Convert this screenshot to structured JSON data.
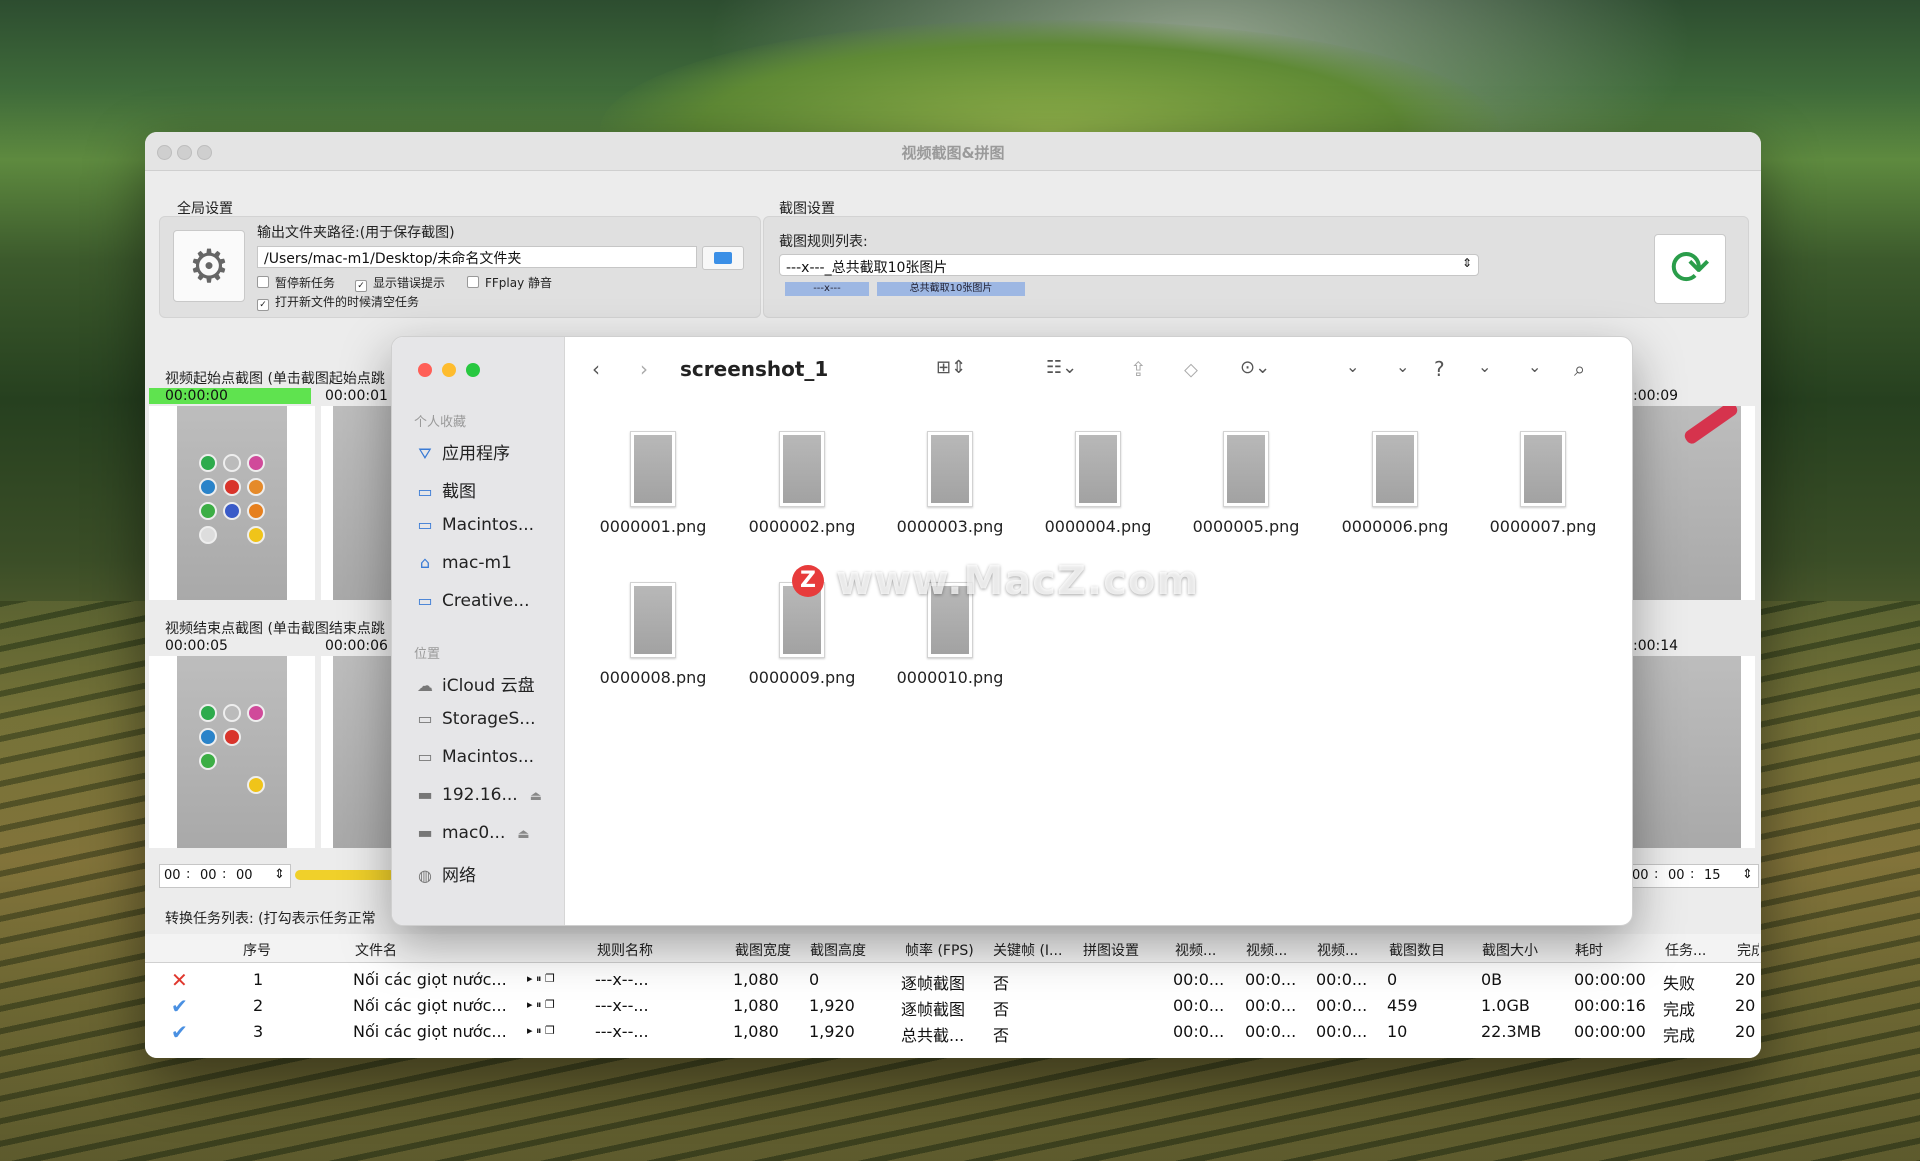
{
  "app": {
    "title": "视频截图&拼图",
    "global_settings_label": "全局设置",
    "output_path_label": "输出文件夹路径:(用于保存截图)",
    "output_path_value": "/Users/mac-m1/Desktop/未命名文件夹",
    "checkboxes": [
      {
        "label": "暂停新任务",
        "checked": false
      },
      {
        "label": "显示错误提示",
        "checked": true
      },
      {
        "label": "FFplay 静音",
        "checked": false
      },
      {
        "label": "打开新文件的时候清空任务",
        "checked": true
      }
    ],
    "capture_settings_label": "截图设置",
    "rule_list_label": "截图规则列表:",
    "rule_selected": "---x---_总共截取10张图片",
    "rule_tag_1": "---x---",
    "rule_tag_2": "总共截取10张图片",
    "start_section_label": "视频起始点截图 (单击截图起始点跳",
    "end_section_label": "视频结束点截图 (单击截图结束点跳",
    "start_times": [
      "00:00:00",
      "00:00:01"
    ],
    "start_time_right": ":00:09",
    "end_times": [
      "00:00:05",
      "00:00:06"
    ],
    "end_time_right": ":00:14",
    "start_spinner": [
      "00",
      "00",
      "00"
    ],
    "end_spinner": [
      "00",
      "00",
      "15"
    ],
    "end_spinner_partial": "00",
    "task_list_label": "转换任务列表: (打勾表示任务正常",
    "table": {
      "headers": [
        "序号",
        "文件名",
        "规则名称",
        "截图宽度",
        "截图高度",
        "帧率 (FPS)",
        "关键帧 (I...",
        "拼图设置",
        "视频...",
        "视频...",
        "视频...",
        "截图数目",
        "截图大小",
        "耗时",
        "任务...",
        "完成"
      ],
      "rows": [
        {
          "status": "fail",
          "num": "1",
          "file": "Nối các giọt nước...",
          "rule": "---x--...",
          "w": "1,080",
          "h": "0",
          "fps": "逐帧截图",
          "key": "否",
          "v1": "00:0...",
          "v2": "00:0...",
          "v3": "00:0...",
          "count": "0",
          "size": "0B",
          "time": "00:00:00",
          "state": "失败",
          "done": "20"
        },
        {
          "status": "ok",
          "num": "2",
          "file": "Nối các giọt nước...",
          "rule": "---x--...",
          "w": "1,080",
          "h": "1,920",
          "fps": "逐帧截图",
          "key": "否",
          "v1": "00:0...",
          "v2": "00:0...",
          "v3": "00:0...",
          "count": "459",
          "size": "1.0GB",
          "time": "00:00:16",
          "state": "完成",
          "done": "20"
        },
        {
          "status": "ok",
          "num": "3",
          "file": "Nối các giọt nước...",
          "rule": "---x--...",
          "w": "1,080",
          "h": "1,920",
          "fps": "总共截...",
          "key": "否",
          "v1": "00:0...",
          "v2": "00:0...",
          "v3": "00:0...",
          "count": "10",
          "size": "22.3MB",
          "time": "00:00:00",
          "state": "完成",
          "done": "20"
        }
      ]
    }
  },
  "finder": {
    "folder_title": "screenshot_1",
    "sidebar": {
      "favorites_label": "个人收藏",
      "favorites": [
        {
          "label": "应用程序",
          "icon": "apps-icon"
        },
        {
          "label": "截图",
          "icon": "folder-icon"
        },
        {
          "label": "Macintos...",
          "icon": "drive-icon"
        },
        {
          "label": "mac-m1",
          "icon": "home-icon"
        },
        {
          "label": "Creative...",
          "icon": "folder-icon"
        }
      ],
      "locations_label": "位置",
      "locations": [
        {
          "label": "iCloud 云盘",
          "icon": "cloud-icon"
        },
        {
          "label": "StorageS...",
          "icon": "drive-icon"
        },
        {
          "label": "Macintos...",
          "icon": "drive-icon"
        },
        {
          "label": "192.16...",
          "icon": "display-icon"
        },
        {
          "label": "mac0...",
          "icon": "display-icon"
        },
        {
          "label": "网络",
          "icon": "network-icon"
        }
      ]
    },
    "files": [
      "0000001.png",
      "0000002.png",
      "0000003.png",
      "0000004.png",
      "0000005.png",
      "0000006.png",
      "0000007.png",
      "0000008.png",
      "0000009.png",
      "0000010.png"
    ]
  },
  "watermark": "www.MacZ.com",
  "watermark_logo": "Z"
}
